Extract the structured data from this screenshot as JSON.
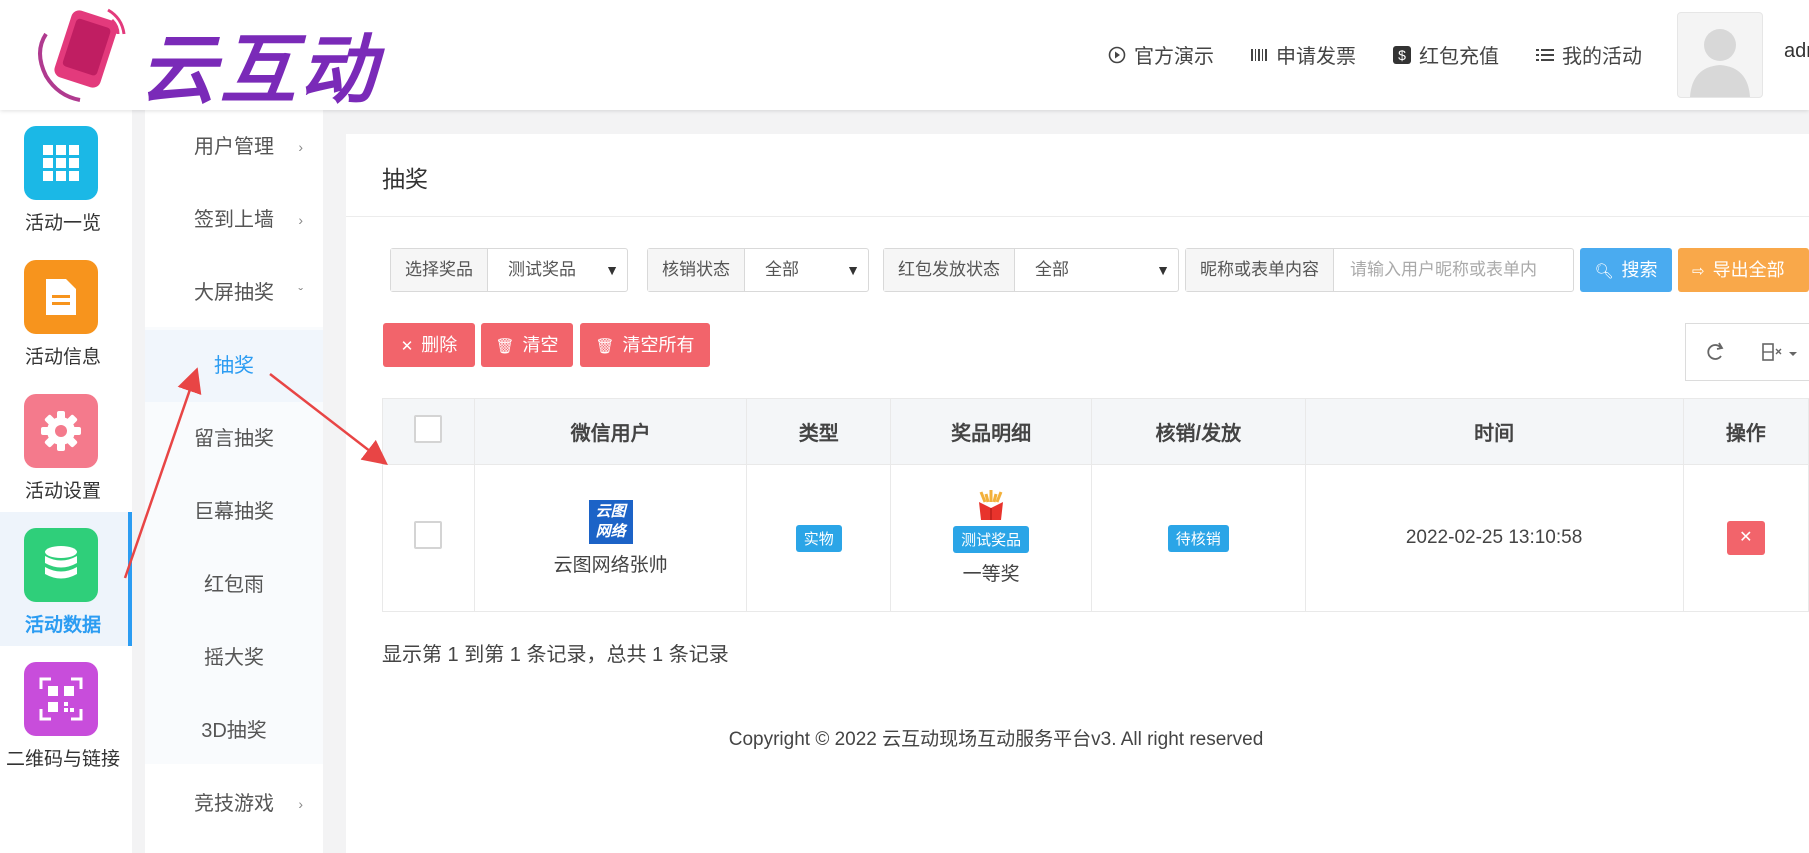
{
  "brand": {
    "name": "云互动"
  },
  "header": {
    "nav": [
      {
        "icon": "play-circle-icon",
        "label": "官方演示"
      },
      {
        "icon": "barcode-icon",
        "label": "申请发票"
      },
      {
        "icon": "dollar-icon",
        "label": "红包充值"
      },
      {
        "icon": "list-icon",
        "label": "我的活动"
      }
    ],
    "username": "adm"
  },
  "apps": [
    {
      "label": "活动一览",
      "color": "#1bb8e6",
      "icon": "grid-icon"
    },
    {
      "label": "活动信息",
      "color": "#f7941d",
      "icon": "document-icon"
    },
    {
      "label": "活动设置",
      "color": "#f47a8c",
      "icon": "gear-icon"
    },
    {
      "label": "活动数据",
      "color": "#2fcf7a",
      "icon": "database-icon",
      "active": true
    },
    {
      "label": "二维码与链接",
      "color": "#c84ddb",
      "icon": "qrcode-icon"
    }
  ],
  "submenu": [
    {
      "label": "用户管理",
      "chevron": "›"
    },
    {
      "label": "签到上墙",
      "chevron": "›"
    },
    {
      "label": "大屏抽奖",
      "chevron": "ˇ"
    },
    {
      "label": "抽奖",
      "selected": true
    },
    {
      "label": "留言抽奖"
    },
    {
      "label": "巨幕抽奖"
    },
    {
      "label": "红包雨"
    },
    {
      "label": "摇大奖"
    },
    {
      "label": "3D抽奖"
    },
    {
      "label": "竞技游戏",
      "chevron": "›"
    }
  ],
  "page": {
    "title": "抽奖"
  },
  "filters": {
    "prize": {
      "label": "选择奖品",
      "value": "测试奖品"
    },
    "verify": {
      "label": "核销状态",
      "value": "全部"
    },
    "redpack": {
      "label": "红包发放状态",
      "value": "全部"
    },
    "keyword": {
      "label": "昵称或表单内容",
      "placeholder": "请输入用户昵称或表单内"
    },
    "search_label": "搜索",
    "export_label": "导出全部"
  },
  "actions": {
    "delete": "删除",
    "clear": "清空",
    "clear_all": "清空所有"
  },
  "table": {
    "columns": [
      "微信用户",
      "类型",
      "奖品明细",
      "核销/发放",
      "时间",
      "操作"
    ],
    "rows": [
      {
        "avatar_text": "云图网络",
        "user": "云图网络张帅",
        "type": "实物",
        "prize_tag": "测试奖品",
        "prize_level": "一等奖",
        "status": "待核销",
        "time": "2022-02-25 13:10:58"
      }
    ]
  },
  "pagination": {
    "summary": "显示第 1 到第 1 条记录，总共 1 条记录"
  },
  "footer": {
    "copyright": "Copyright © 2022 云互动现场互动服务平台v3. All right reserved"
  },
  "colors": {
    "accent": "#2b9cf2",
    "danger": "#f2646b",
    "search": "#4aabf0",
    "export": "#f9a84a",
    "badge": "#2ba5e7"
  }
}
